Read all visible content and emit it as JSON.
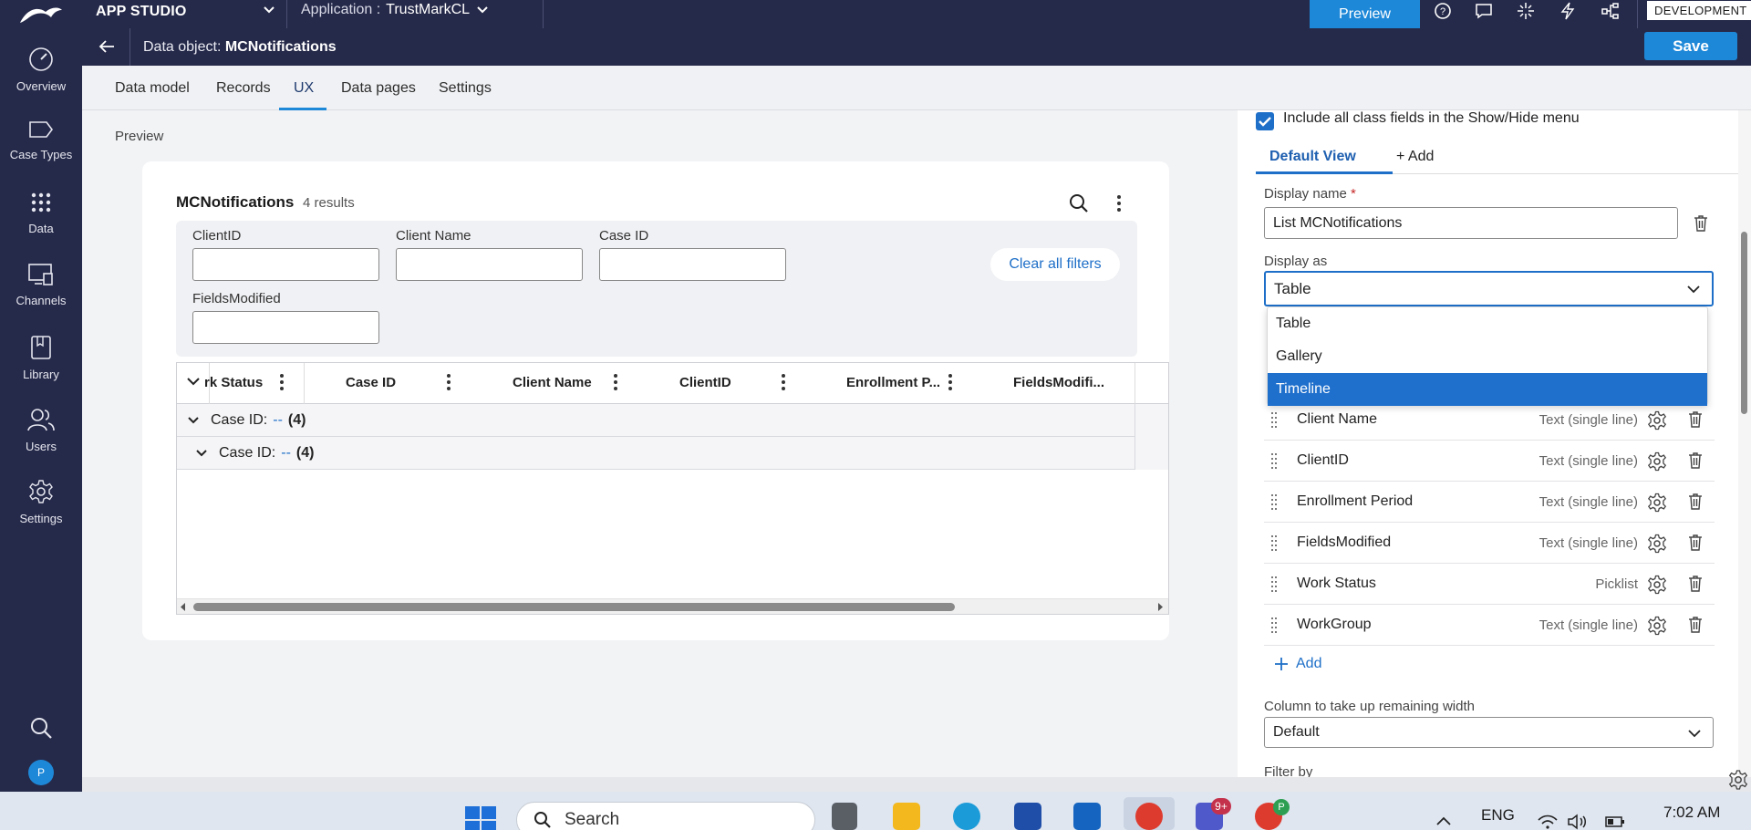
{
  "topbar": {
    "studio": "APP STUDIO",
    "application_prefix": "Application :",
    "application_name": "TrustMarkCL",
    "preview": "Preview",
    "environment": "DEVELOPMENT"
  },
  "leftnav": {
    "items": [
      {
        "label": "Overview",
        "icon": "gauge-icon"
      },
      {
        "label": "Case Types",
        "icon": "case-type-icon"
      },
      {
        "label": "Data",
        "icon": "data-grid-icon"
      },
      {
        "label": "Channels",
        "icon": "channels-icon"
      },
      {
        "label": "Library",
        "icon": "library-icon"
      },
      {
        "label": "Users",
        "icon": "users-icon"
      },
      {
        "label": "Settings",
        "icon": "gear-icon"
      }
    ],
    "avatar": "P"
  },
  "header": {
    "prefix": "Data object:",
    "name": "MCNotifications",
    "save": "Save"
  },
  "tabs": [
    "Data model",
    "Records",
    "UX",
    "Data pages",
    "Settings"
  ],
  "active_tab": "UX",
  "preview_label": "Preview",
  "card": {
    "title": "MCNotifications",
    "count": "4 results",
    "filters": [
      {
        "label": "ClientID",
        "value": ""
      },
      {
        "label": "Client Name",
        "value": ""
      },
      {
        "label": "Case ID",
        "value": ""
      },
      {
        "label": "FieldsModified",
        "value": ""
      }
    ],
    "clear_filters": "Clear all filters",
    "columns": [
      "rk Status",
      "Case ID",
      "Client Name",
      "ClientID",
      "Enrollment P...",
      "FieldsModifi..."
    ],
    "groups": [
      {
        "label": "Case ID:",
        "value": "--",
        "count": "(4)"
      },
      {
        "label": "Case ID:",
        "value": "--",
        "count": "(4)"
      }
    ]
  },
  "panel": {
    "include_all": "Include all class fields in the Show/Hide menu",
    "view_tab": "Default View",
    "add_tab": "+ Add",
    "display_name_label": "Display name",
    "display_name_required": "*",
    "display_name_value": "List MCNotifications",
    "display_as_label": "Display as",
    "display_as_value": "Table",
    "display_as_options": [
      "Table",
      "Gallery",
      "Timeline"
    ],
    "highlighted_option": "Timeline",
    "fields": [
      {
        "name": "Client Name",
        "type": "Text (single line)"
      },
      {
        "name": "ClientID",
        "type": "Text (single line)"
      },
      {
        "name": "Enrollment Period",
        "type": "Text (single line)"
      },
      {
        "name": "FieldsModified",
        "type": "Text (single line)"
      },
      {
        "name": "Work Status",
        "type": "Picklist"
      },
      {
        "name": "WorkGroup",
        "type": "Text (single line)"
      }
    ],
    "add_field": "Add",
    "remaining_width_label": "Column to take up remaining width",
    "remaining_width_value": "Default",
    "filter_by_label": "Filter by"
  },
  "taskbar": {
    "search_placeholder": "Search",
    "language": "ENG",
    "time": "7:02 AM",
    "teams_badge": "9+",
    "chrome_profile": "P"
  },
  "colors": {
    "nav_bg": "#262a4a",
    "accent": "#1e88d8",
    "selected_option": "#1f6fcc"
  }
}
